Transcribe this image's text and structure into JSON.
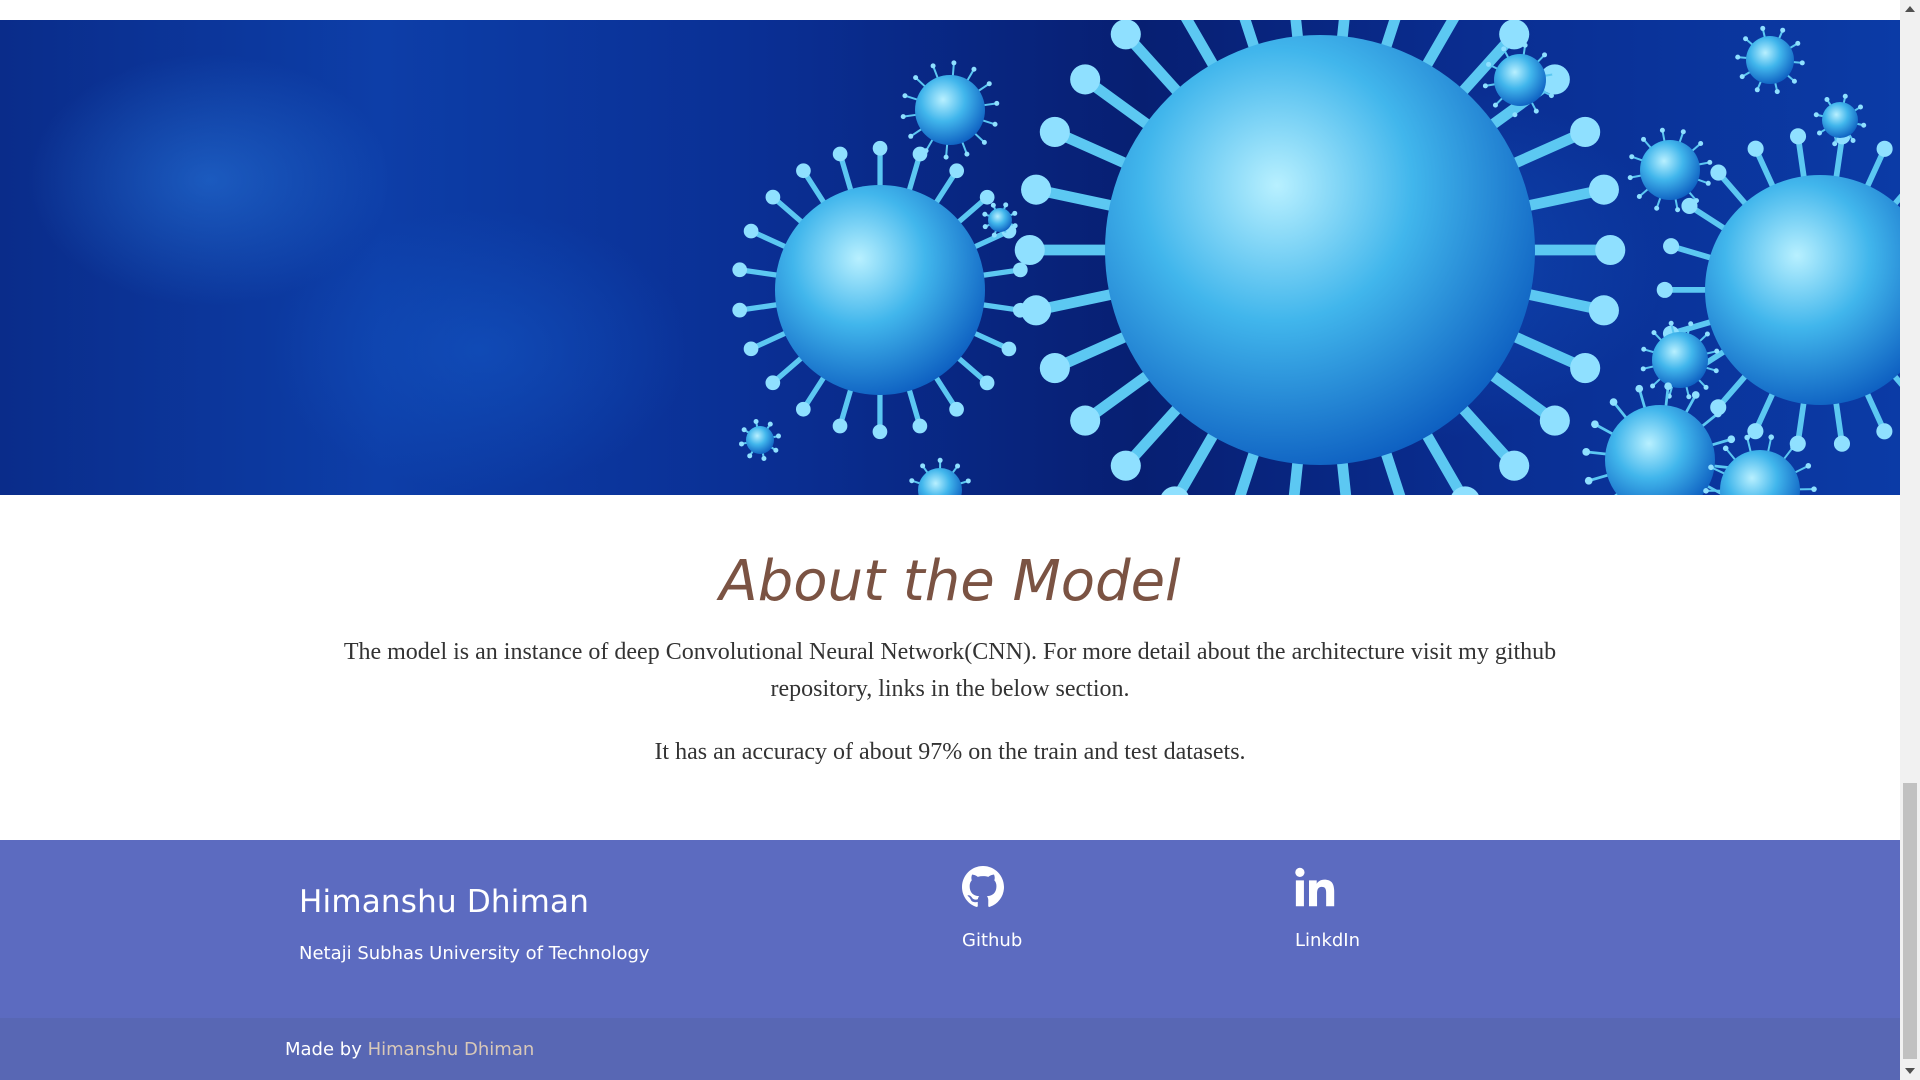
{
  "hero": {
    "image": "coronavirus-banner-image"
  },
  "about": {
    "title": "About the Model",
    "description": "The model is an instance of deep Convolutional Neural Network(CNN). For more detail about the architecture visit my github repository, links in the below section.",
    "accuracy_text": "It has an accuracy of about 97% on the train and test datasets."
  },
  "footer": {
    "name": "Himanshu Dhiman",
    "university": "Netaji Subhas University of Technology",
    "links": [
      {
        "label": "Github",
        "icon": "github-icon"
      },
      {
        "label": "LinkdIn",
        "icon": "linkedin-icon"
      }
    ],
    "copyright_prefix": "Made by ",
    "copyright_author": "Himanshu Dhiman"
  },
  "colors": {
    "title": "#7b5343",
    "text": "#333333",
    "footer_bg": "#5c6bc0",
    "copyright_bg": "#5867b4",
    "author_link": "#d8c8b8"
  }
}
